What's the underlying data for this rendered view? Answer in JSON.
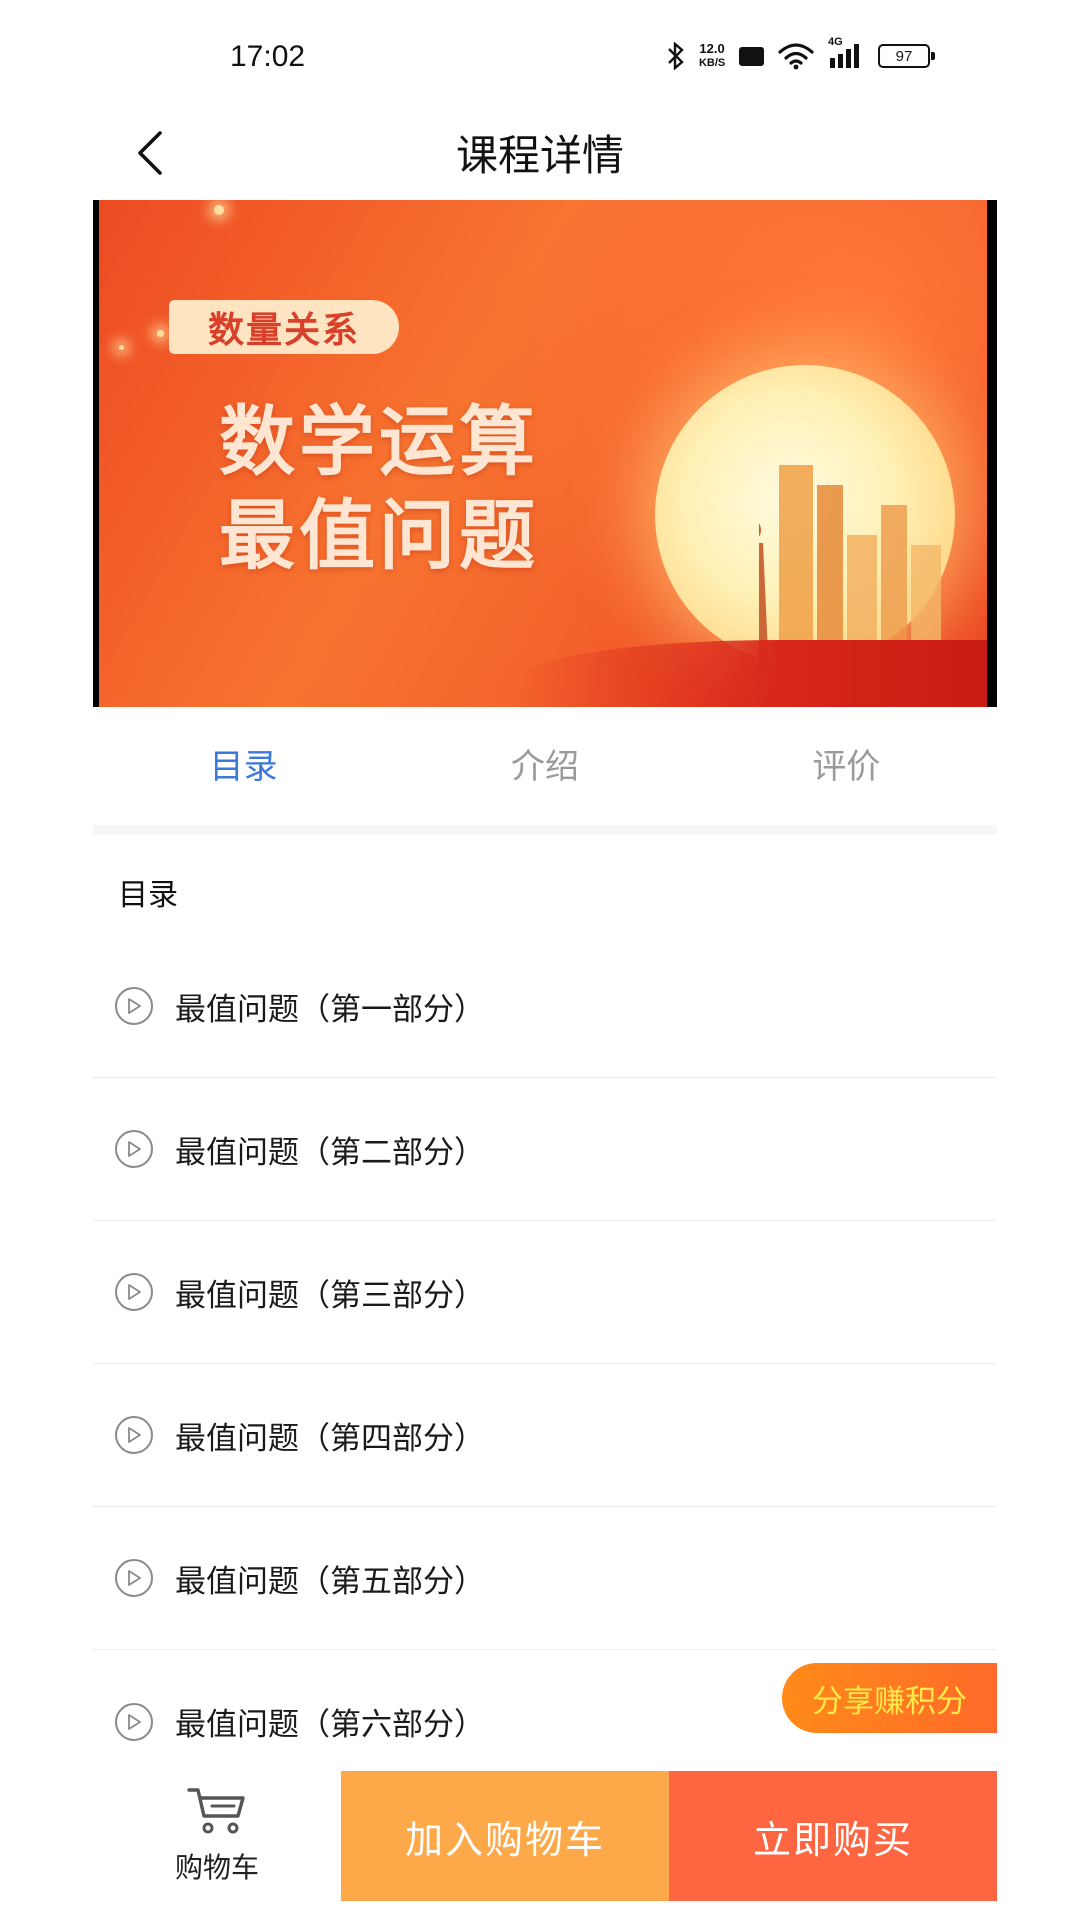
{
  "status_bar": {
    "time": "17:02",
    "net_speed_value": "12.0",
    "net_speed_unit": "KB/S",
    "hd_label": "HD",
    "network_label": "4G",
    "battery": "97",
    "icons": [
      "bluetooth-icon",
      "hd-icon",
      "wifi-icon",
      "signal-icon",
      "battery-icon"
    ]
  },
  "header": {
    "back_icon": "chevron-left-icon",
    "title": "课程详情"
  },
  "banner": {
    "tag": "数量关系",
    "title_line1": "数学运算",
    "title_line2": "最值问题"
  },
  "tabs": [
    {
      "label": "目录",
      "active": true
    },
    {
      "label": "介绍",
      "active": false
    },
    {
      "label": "评价",
      "active": false
    }
  ],
  "catalog": {
    "heading": "目录",
    "items": [
      {
        "title": "最值问题（第一部分）",
        "icon": "play-icon"
      },
      {
        "title": "最值问题（第二部分）",
        "icon": "play-icon"
      },
      {
        "title": "最值问题（第三部分）",
        "icon": "play-icon"
      },
      {
        "title": "最值问题（第四部分）",
        "icon": "play-icon"
      },
      {
        "title": "最值问题（第五部分）",
        "icon": "play-icon"
      },
      {
        "title": "最值问题（第六部分）",
        "icon": "play-icon"
      }
    ]
  },
  "share_badge": "分享赚积分",
  "bottom_bar": {
    "cart_label": "购物车",
    "cart_icon": "cart-icon",
    "add_to_cart": "加入购物车",
    "buy_now": "立即购买"
  },
  "colors": {
    "accent": "#3c79d8",
    "add_to_cart_bg": "#fda94a",
    "buy_now_bg": "#fe6541",
    "share_text": "#ffe94a"
  }
}
